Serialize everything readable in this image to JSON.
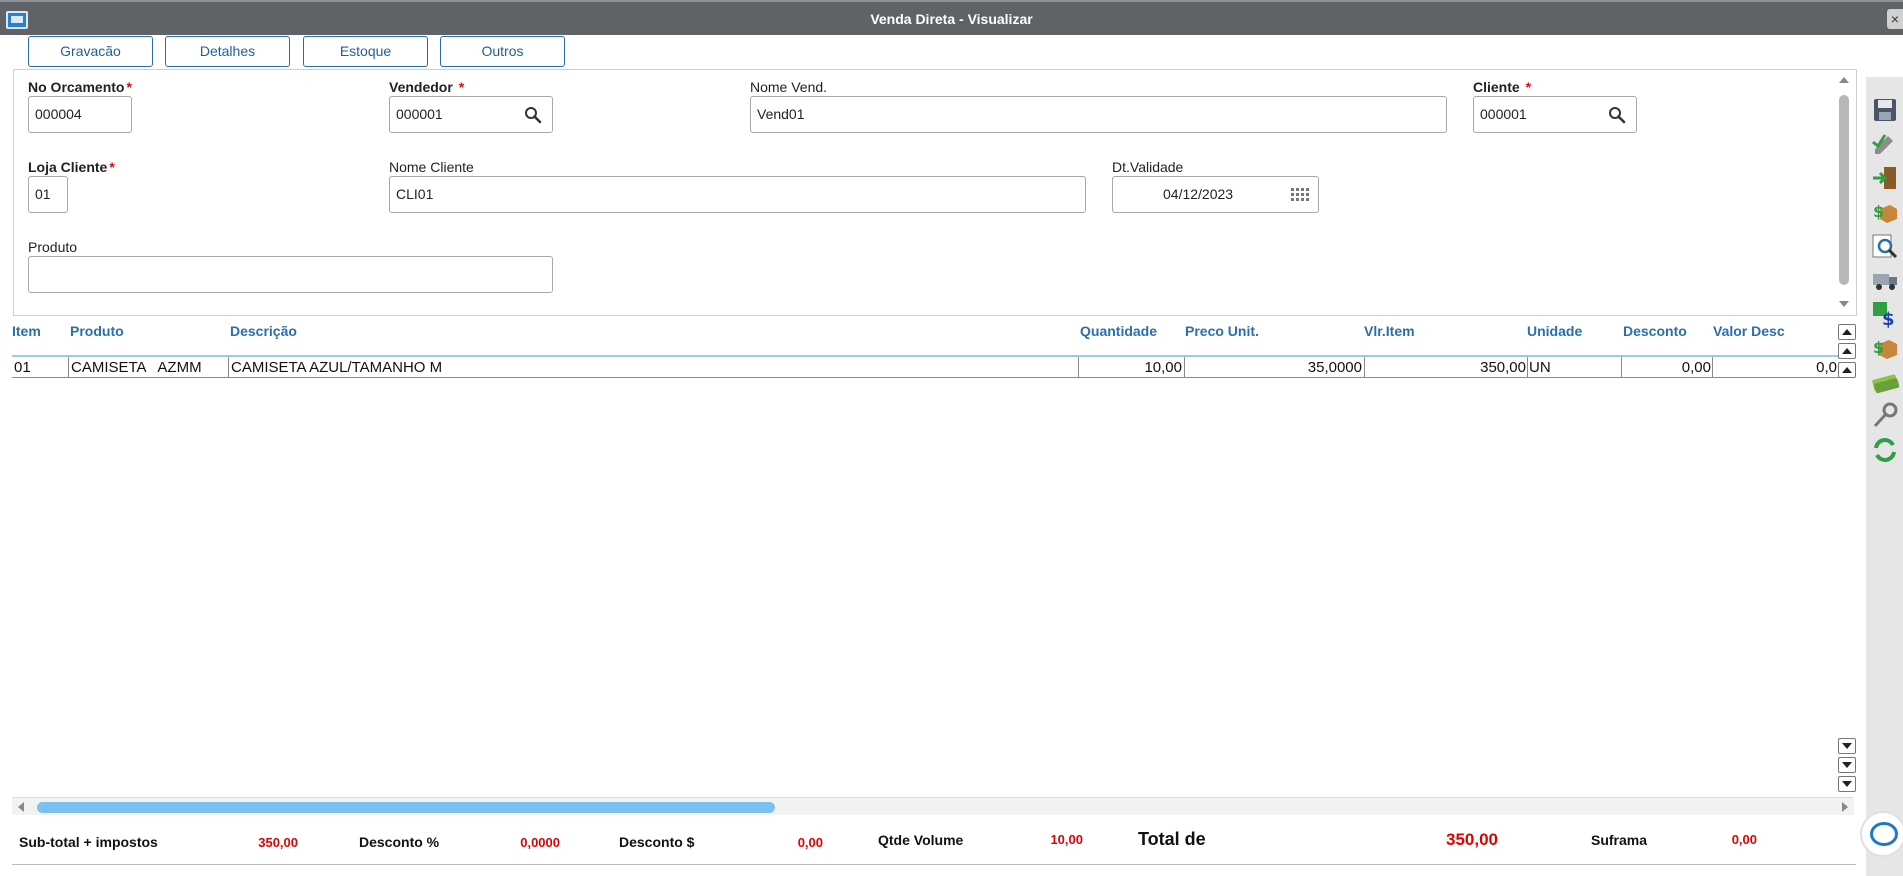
{
  "window": {
    "title": "Venda Direta - Visualizar",
    "close_glyph": "×"
  },
  "top_buttons": [
    "Gravacão",
    "Detalhes",
    "Estoque",
    "Outros"
  ],
  "form": {
    "no_orcamento": {
      "label": "No Orcamento",
      "value": "000004"
    },
    "vendedor": {
      "label": "Vendedor",
      "value": "000001"
    },
    "nome_vend": {
      "label": "Nome Vend.",
      "value": "Vend01"
    },
    "cliente": {
      "label": "Cliente",
      "value": "000001"
    },
    "loja_cliente": {
      "label": "Loja Cliente",
      "value": "01"
    },
    "nome_cliente": {
      "label": "Nome Cliente",
      "value": "CLI01"
    },
    "dt_validade": {
      "label": "Dt.Validade",
      "value": "04/12/2023"
    },
    "produto": {
      "label": "Produto",
      "value": ""
    },
    "required_mark": "*"
  },
  "grid": {
    "columns": [
      "Item",
      "Produto",
      "Descrição",
      "Quantidade",
      "Preco Unit.",
      "Vlr.Item",
      "Unidade",
      "Desconto",
      "Valor Desc"
    ],
    "rows": [
      {
        "item": "01",
        "produto": "CAMISETA   AZMM",
        "descricao": "CAMISETA AZUL/TAMANHO M",
        "quantidade": "10,00",
        "preco_unit": "35,0000",
        "vlr_item": "350,00",
        "unidade": "UN",
        "desconto": "0,00",
        "valor_desc": "0,0"
      }
    ]
  },
  "totals": {
    "subtotal": {
      "label": "Sub-total + impostos",
      "value": "350,00"
    },
    "desconto_pct": {
      "label": "Desconto %",
      "value": "0,0000"
    },
    "desconto_val": {
      "label": "Desconto $",
      "value": "0,00"
    },
    "qtde_volume": {
      "label": "Qtde Volume",
      "value": "10,00"
    },
    "total": {
      "label": "Total de",
      "value": "350,00"
    },
    "suframa": {
      "label": "Suframa",
      "value": "0,00"
    }
  },
  "sidebar_icons": [
    "save-icon",
    "edit-icon",
    "exit-icon",
    "money-box-icon",
    "zoom-icon",
    "truck-icon",
    "exchange-icon",
    "box-money-icon",
    "cash-icon",
    "key-icon",
    "refresh-icon"
  ],
  "colors": {
    "titlebar": "#5f6267",
    "accent": "#2a6fa8",
    "total_red": "#e00000",
    "scroll_thumb": "#7cc0f0"
  }
}
